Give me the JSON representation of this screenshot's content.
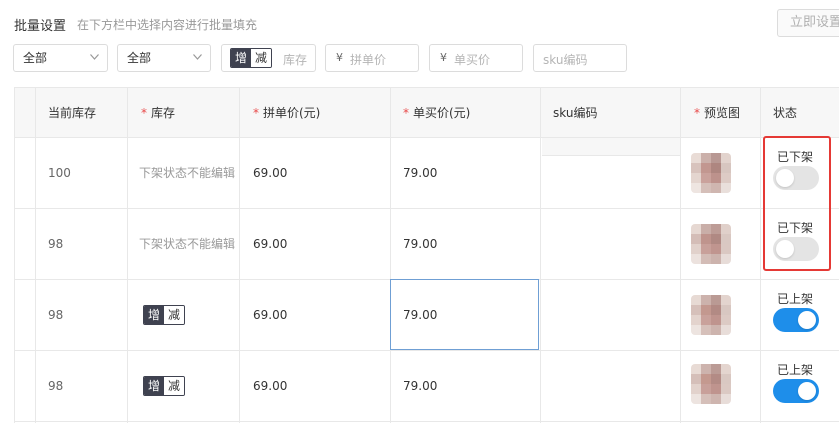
{
  "header": {
    "title": "批量设置",
    "hint": "在下方栏中选择内容进行批量填充",
    "apply_button": "立即设置"
  },
  "filters": {
    "select1": "全部",
    "select2": "全部",
    "stock_toggle": {
      "increase": "增",
      "decrease": "减"
    },
    "stock_placeholder": "库存",
    "currency": "¥",
    "group_price_placeholder": "拼单价",
    "single_price_placeholder": "单买价",
    "sku_placeholder": "sku编码"
  },
  "table": {
    "columns": [
      {
        "label": "当前库存",
        "required": false
      },
      {
        "label": "库存",
        "required": true
      },
      {
        "label": "拼单价(元)",
        "required": true
      },
      {
        "label": "单买价(元)",
        "required": true
      },
      {
        "label": "sku编码",
        "required": false
      },
      {
        "label": "预览图",
        "required": true
      },
      {
        "label": "状态",
        "required": false
      }
    ],
    "required_mark": "*",
    "rows": [
      {
        "current_stock": "100",
        "stock_text": "下架状态不能编辑",
        "group_price": "69.00",
        "single_price": "79.00",
        "sku": "",
        "status_label": "已下架",
        "status_on": false
      },
      {
        "current_stock": "98",
        "stock_text": "下架状态不能编辑",
        "group_price": "69.00",
        "single_price": "79.00",
        "sku": "",
        "status_label": "已下架",
        "status_on": false
      },
      {
        "current_stock": "98",
        "stock_text": "",
        "stock_toggle": {
          "increase": "增",
          "decrease": "减"
        },
        "group_price": "69.00",
        "single_price": "79.00",
        "sku": "",
        "status_label": "已上架",
        "status_on": true
      },
      {
        "current_stock": "98",
        "stock_text": "",
        "stock_toggle": {
          "increase": "增",
          "decrease": "减"
        },
        "group_price": "69.00",
        "single_price": "79.00",
        "sku": "",
        "status_label": "已上架",
        "status_on": true
      }
    ]
  },
  "colors": {
    "accent_blue": "#1e8eea",
    "highlight_red": "#e53935",
    "required_red": "#e84a4a",
    "toggle_dark": "#3f4250"
  }
}
